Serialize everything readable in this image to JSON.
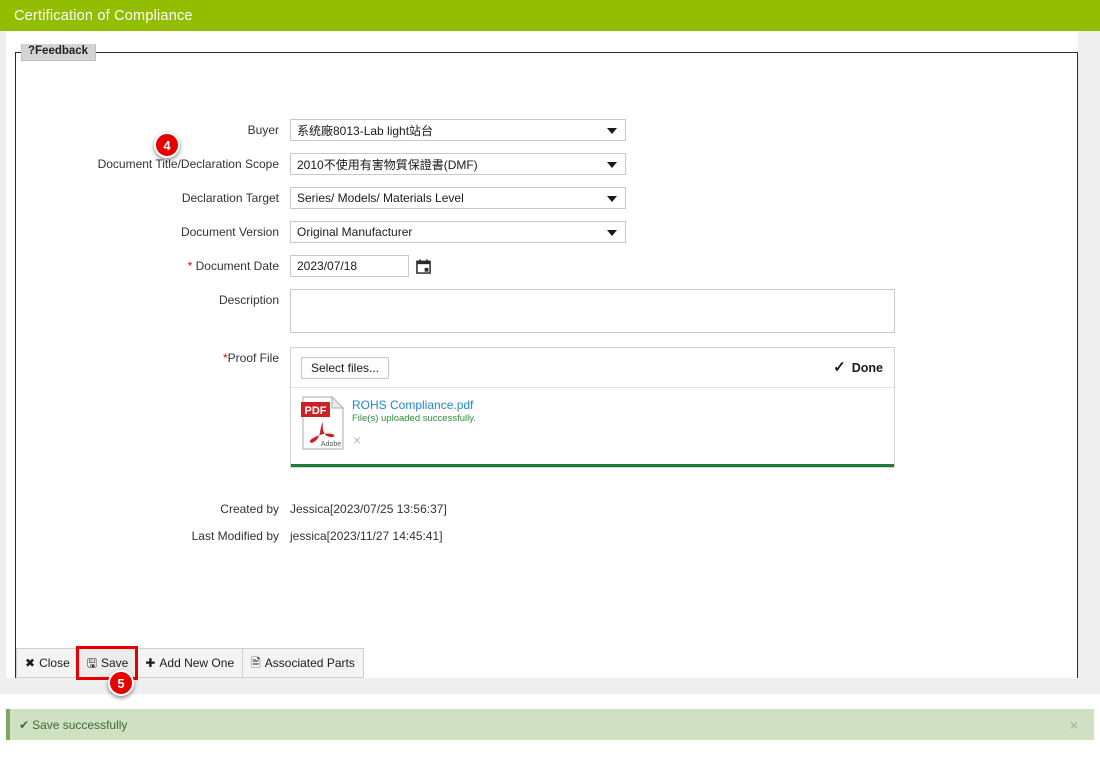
{
  "window": {
    "title": "Certification of Compliance",
    "header_color": "#93bd00"
  },
  "feedback_tab": {
    "label": "?Feedback"
  },
  "step_markers": [
    {
      "number": "4"
    },
    {
      "number": "5"
    }
  ],
  "form": {
    "buyer": {
      "label": "Buyer",
      "value": "系统廠8013-Lab light站台"
    },
    "document_title": {
      "label": "Document Title/Declaration Scope",
      "value": "2010不使用有害物質保證書(DMF)"
    },
    "declaration_target": {
      "label": "Declaration Target",
      "value": "Series/ Models/ Materials Level"
    },
    "document_version": {
      "label": "Document Version",
      "value": "Original Manufacturer"
    },
    "document_date": {
      "label": "Document Date",
      "required_mark": "*",
      "value": "2023/07/18"
    },
    "description": {
      "label": "Description",
      "value": "",
      "placeholder": ""
    },
    "proof_file": {
      "label": "Proof File",
      "required_mark": "*",
      "select_button": "Select files...",
      "status_label": "Done",
      "file": {
        "name": "ROHS Compliance.pdf",
        "status": "File(s) uploaded successfully.",
        "icon": "pdf-icon",
        "remove_label": "×"
      },
      "progress_color": "#1e7a35"
    },
    "created_by": {
      "label": "Created by",
      "value": "Jessica[2023/07/25 13:56:37]"
    },
    "last_modified_by": {
      "label": "Last Modified by",
      "value": "jessica[2023/11/27 14:45:41]"
    }
  },
  "toolbar": {
    "close_label": "Close",
    "close_icon": "✖",
    "save_label": "Save",
    "save_icon": "🖫",
    "add_new_label": "Add New One",
    "add_new_icon": "✚",
    "associated_parts_label": "Associated Parts",
    "associated_parts_icon": "🖹"
  },
  "toast": {
    "message": "Save successfully",
    "icon": "✔",
    "close": "×",
    "background": "#cfe0c3",
    "text_color": "#3b6b33"
  }
}
